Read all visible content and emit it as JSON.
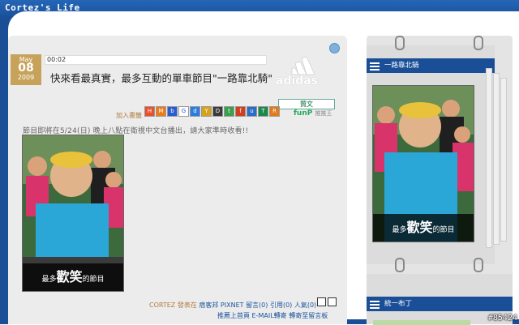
{
  "site": {
    "title": "Cortez's Life"
  },
  "post": {
    "date": {
      "month": "May",
      "day": "08",
      "year": "2009"
    },
    "time": "00:02",
    "title": "快來看最真實，最多互動的單車節目\"一路靠北騎\"",
    "brand_text": "adidas",
    "share_label": "加入書籤",
    "like_label": "贊文",
    "funp_label": "funP",
    "funp_sub": "推推王",
    "intro": "節目即將在5/24(日) 晚上八點在衛視中文台播出，請大家準時收看!!",
    "image_caption_prefix": "最多",
    "image_caption_big": "歡笑",
    "image_caption_suffix": "的節目",
    "footer": {
      "author": "CORTEZ 發表在",
      "pixnet": "痞客邦",
      "pixnet2": "PIXNET",
      "comments": "留言(0)",
      "trackback": "引用(0)",
      "views": "人氣(0)",
      "line2": "推薦上首頁  E-MAIL轉寄  轉寄至留言板"
    }
  },
  "sidebar": {
    "widgets": [
      {
        "title": "一路靠北騎",
        "caption_prefix": "最多",
        "caption_big": "歡笑",
        "caption_suffix": "的節目"
      },
      {
        "title": "統一布丁"
      }
    ]
  },
  "watermark": "#85424",
  "colors": {
    "brand_blue": "#1a4f98",
    "date_gold": "#c7a25b"
  }
}
